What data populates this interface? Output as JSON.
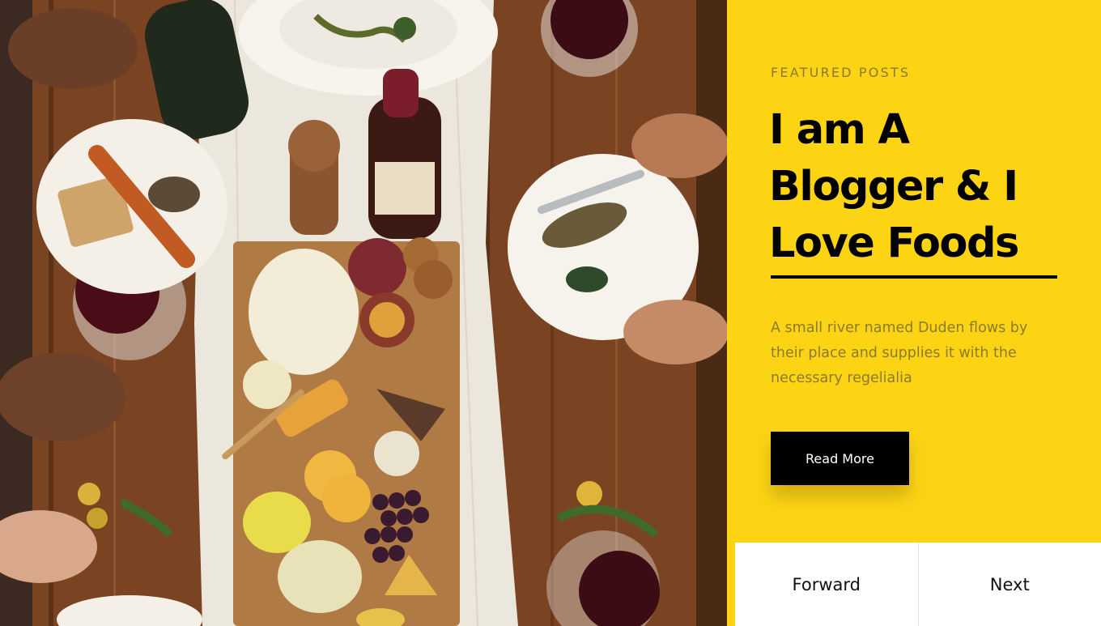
{
  "hero": {
    "image_alt": "food on wooden table",
    "icon": "food-photo"
  },
  "featured": {
    "eyebrow": "FEATURED POSTS",
    "headline_line1": "I am A",
    "headline_line2": "Blogger & I",
    "headline_line3": "Love Foods",
    "description": "A small river named Duden flows by their place and supplies it with the necessary regelialia",
    "read_more_label": "Read More"
  },
  "pager": {
    "forward_label": "Forward",
    "next_label": "Next"
  },
  "colors": {
    "accent": "#fdd414",
    "button": "#000000",
    "muted_text": "#8a7a2e"
  }
}
